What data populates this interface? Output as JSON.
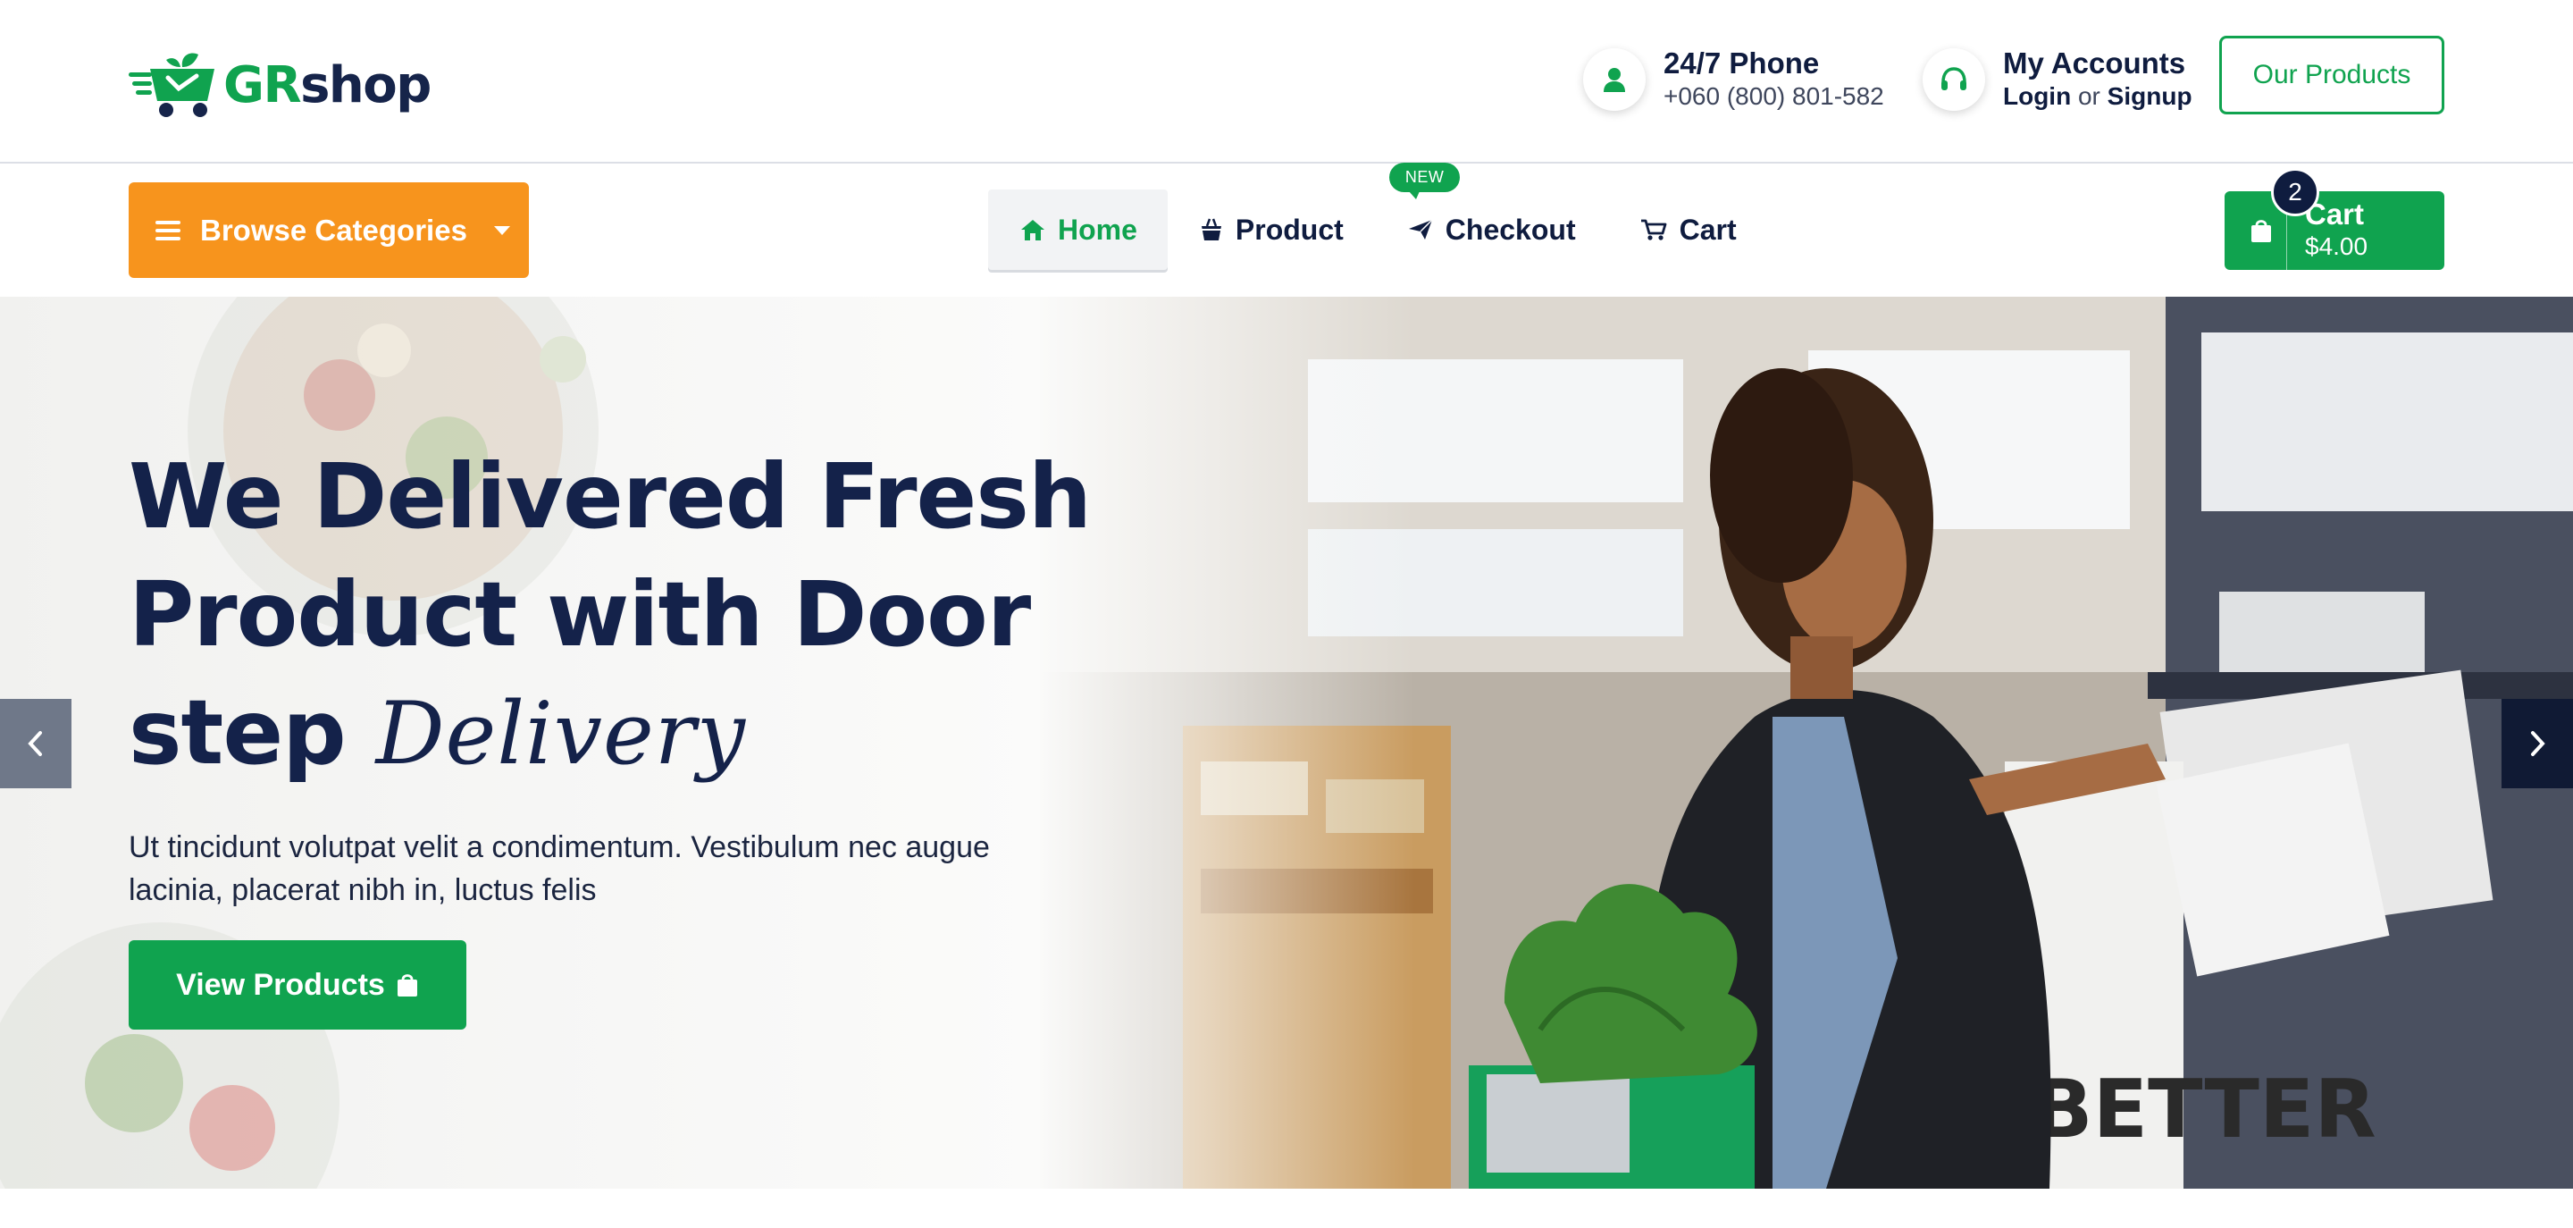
{
  "brand": {
    "logo_part1": "GR",
    "logo_part2": "shop",
    "accent_color": "#10a34f",
    "dark_color": "#0f1c3f",
    "orange_color": "#f7941d"
  },
  "header": {
    "phone": {
      "title": "24/7 Phone",
      "number": "+060 (800) 801-582",
      "icon": "user-icon"
    },
    "account": {
      "title": "My Accounts",
      "login": "Login",
      "or": "or",
      "signup": "Signup",
      "icon": "headset-icon"
    },
    "our_products_label": "Our Products"
  },
  "nav": {
    "browse_label": "Browse Categories",
    "items": [
      {
        "label": "Home",
        "icon": "home-icon",
        "active": true
      },
      {
        "label": "Product",
        "icon": "basket-icon",
        "badge": "NEW"
      },
      {
        "label": "Checkout",
        "icon": "send-icon"
      },
      {
        "label": "Cart",
        "icon": "cart-icon"
      }
    ],
    "cart": {
      "label": "Cart",
      "total": "$4.00",
      "count": "2"
    }
  },
  "hero": {
    "title_line1": "We Delivered Fresh",
    "title_line2": "Product with Door",
    "title_line3": "step",
    "title_script": "Delivery",
    "description": "Ut tincidunt volutpat velit a condimentum. Vestibulum nec augue lacinia, placerat nibh in, luctus felis",
    "cta_label": "View Products"
  }
}
